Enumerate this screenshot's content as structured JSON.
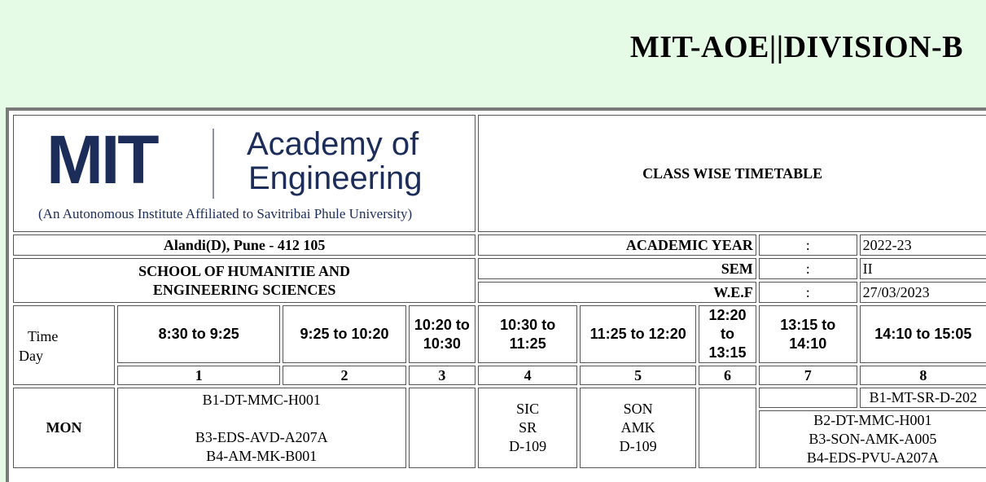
{
  "header": {
    "title": "MIT-AOE||DIVISION-B"
  },
  "logo": {
    "mit": "MIT",
    "name_line1": "Academy of",
    "name_line2": "Engineering",
    "affiliation": "(An Autonomous Institute Affiliated to Savitribai Phule University)"
  },
  "info": {
    "doc_title": "CLASS WISE TIMETABLE",
    "address": "Alandi(D), Pune - 412 105",
    "school": "SCHOOL OF HUMANITIE AND ENGINEERING SCIENCES",
    "rows": [
      {
        "label": "ACADEMIC YEAR",
        "sep": ":",
        "value": "2022-23"
      },
      {
        "label": "SEM",
        "sep": ":",
        "value": "II"
      },
      {
        "label": "W.E.F",
        "sep": ":",
        "value": "27/03/2023"
      }
    ]
  },
  "timetable": {
    "corner": {
      "time": "Time",
      "day": "Day"
    },
    "slots": [
      {
        "time": "8:30 to 9:25",
        "num": "1"
      },
      {
        "time": "9:25 to 10:20",
        "num": "2"
      },
      {
        "time": "10:20 to 10:30",
        "num": "3"
      },
      {
        "time": "10:30 to 11:25",
        "num": "4"
      },
      {
        "time": "11:25 to 12:20",
        "num": "5"
      },
      {
        "time": "12:20 to 13:15",
        "num": "6"
      },
      {
        "time": "13:15 to 14:10",
        "num": "7"
      },
      {
        "time": "14:10 to 15:05",
        "num": "8"
      }
    ],
    "monday": {
      "day": "MON",
      "slot12": [
        "B1-DT-MMC-H001",
        "",
        "B3-EDS-AVD-A207A",
        "B4-AM-MK-B001"
      ],
      "slot4": [
        "SIC",
        "SR",
        "D-109"
      ],
      "slot5": [
        "SON",
        "AMK",
        "D-109"
      ],
      "slot8_top": "B1-MT-SR-D-202",
      "slot78": [
        "B2-DT-MMC-H001",
        "B3-SON-AMK-A005",
        "B4-EDS-PVU-A207A"
      ]
    }
  }
}
